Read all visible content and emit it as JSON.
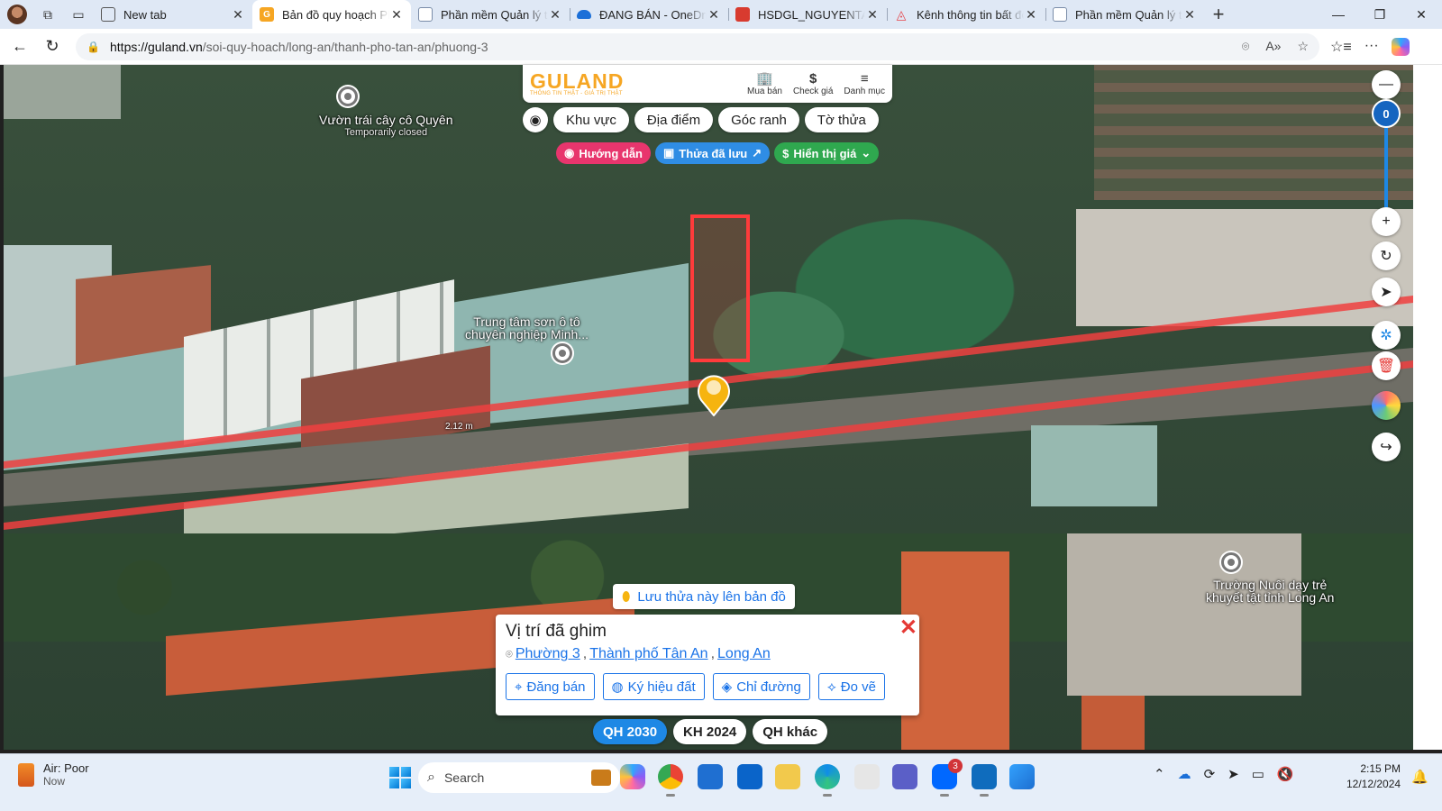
{
  "browser": {
    "tabs": [
      {
        "title": "New tab",
        "active": false,
        "favicon": "new-tab-icon"
      },
      {
        "title": "Bản đồ quy hoạch Phư",
        "active": true,
        "favicon": "guland-favicon"
      },
      {
        "title": "Phần mềm Quản lý tài",
        "active": false,
        "favicon": "page-icon"
      },
      {
        "title": "ĐANG BÁN - OneDrive",
        "active": false,
        "favicon": "onedrive-icon"
      },
      {
        "title": "HSDGL_NGUYENTAND",
        "active": false,
        "favicon": "pdf-icon"
      },
      {
        "title": "Kênh thông tin bất độ",
        "active": false,
        "favicon": "realestate-icon"
      },
      {
        "title": "Phần mềm Quản lý tài",
        "active": false,
        "favicon": "page-icon"
      }
    ],
    "url_host": "https://guland.vn",
    "url_path": "/soi-quy-hoach/long-an/thanh-pho-tan-an/phuong-3"
  },
  "guland": {
    "logo": "GULAND",
    "tagline": "THÔNG TIN THẬT - GIÁ TRỊ THẬT",
    "actions": [
      {
        "icon": "building-icon",
        "glyph": "🏢",
        "label": "Mua bán"
      },
      {
        "icon": "dollar-icon",
        "glyph": "$",
        "label": "Check giá"
      },
      {
        "icon": "menu-icon",
        "glyph": "≡",
        "label": "Danh mục"
      }
    ],
    "filters": [
      "Khu vực",
      "Địa điểm",
      "Góc ranh",
      "Tờ thửa"
    ],
    "pills": [
      {
        "label": "Hướng dẫn",
        "color": "#e8356d",
        "icon": "record-icon",
        "glyph": "◉"
      },
      {
        "label": "Thửa đã lưu",
        "color": "#2f8de4",
        "icon": "bookmark-icon",
        "glyph": "▣",
        "trail": "↗"
      },
      {
        "label": "Hiển thị giá",
        "color": "#2fa84f",
        "icon": "dollar-icon",
        "glyph": "$",
        "trail": "⌄"
      }
    ]
  },
  "map": {
    "labels": {
      "orchard_name": "Vườn trái cây cô Quyên",
      "orchard_status": "Temporarily closed",
      "paint_line1": "Trung tâm sơn ô tô",
      "paint_line2": "chuyên nghiệp Minh...",
      "school_line1": "Trường Nuôi dạy trẻ",
      "school_line2": "khuyết tật tỉnh Long An",
      "scale": "2.12 m"
    },
    "zoom_level": "0",
    "save_parcel": "Lưu thửa này lên bản đồ",
    "popup": {
      "title": "Vị trí đã ghim",
      "ward": "Phường 3",
      "city": "Thành phố Tân An",
      "province": "Long An",
      "buttons": [
        {
          "label": "Đăng bán",
          "icon": "pin-plus-icon",
          "glyph": "⌖"
        },
        {
          "label": "Ký hiệu đất",
          "icon": "palette-icon",
          "glyph": "◍"
        },
        {
          "label": "Chỉ đường",
          "icon": "directions-icon",
          "glyph": "◈"
        },
        {
          "label": "Đo vẽ",
          "icon": "measure-icon",
          "glyph": "⟡"
        }
      ]
    },
    "layers": [
      {
        "label": "QH 2030",
        "active": true
      },
      {
        "label": "KH 2024",
        "active": false
      },
      {
        "label": "QH khác",
        "active": false
      }
    ]
  },
  "taskbar": {
    "weather_title": "Air: Poor",
    "weather_sub": "Now",
    "search_placeholder": "Search",
    "zalo_badge": "3",
    "time": "2:15 PM",
    "date": "12/12/2024"
  }
}
